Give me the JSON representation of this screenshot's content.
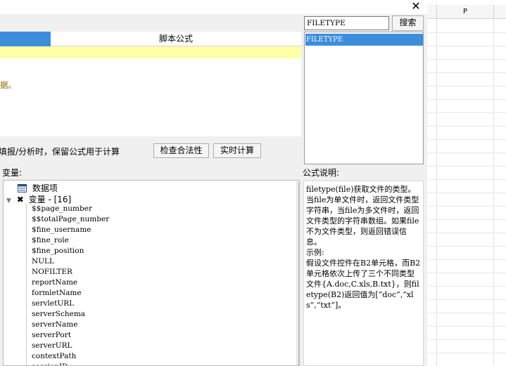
{
  "window": {
    "close_glyph": "✕"
  },
  "tabs": {
    "script_formula": "脚本公式"
  },
  "editor": {
    "partial_text": "据。"
  },
  "options": {
    "keep_formula_text": "填报/分析时，保留公式用于计算"
  },
  "buttons": {
    "check_validity": "检查合法性",
    "realtime_calc": "实时计算",
    "search": "搜索"
  },
  "variables": {
    "label": "变量:",
    "dataset_node": "数据项",
    "variable_node": "变量 - [16]",
    "items": [
      "$$page_number",
      "$$totalPage_number",
      "$fine_username",
      "$fine_role",
      "$fine_position",
      "NULL",
      "NOFILTER",
      "reportName",
      "formletName",
      "servletURL",
      "serverSchema",
      "serverName",
      "serverPort",
      "serverURL",
      "contextPath",
      "sessionID"
    ]
  },
  "search": {
    "value": "FILETYPE"
  },
  "function_list": {
    "selected": "FILETYPE"
  },
  "description": {
    "label": "公式说明:",
    "text": "filetype(file)获取文件的类型。当file为单文件时，返回文件类型字符串，当file为多文件时，返回文件类型的字符串数组。如果file不为文件类型，则返回错误信息。\n示例:\n假设文件控件在B2单元格，而B2单元格依次上传了三个不同类型文件{A.doc,C.xls,B.txt}，则filetype(B2)返回值为[“doc”,“xls”,“txt”]。"
  },
  "spreadsheet": {
    "column_header": "P"
  },
  "colors": {
    "accent": "#3c8ddc",
    "highlight": "#ffffa8"
  }
}
